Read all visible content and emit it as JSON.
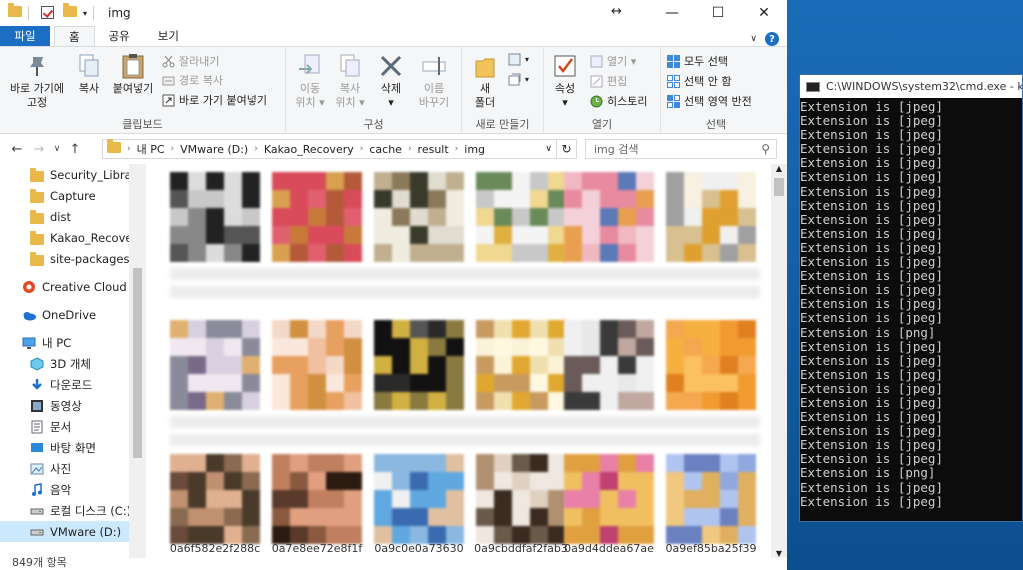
{
  "explorer": {
    "title": "img",
    "window_buttons": {
      "minimize": "—",
      "maximize": "☐",
      "close": "✕"
    },
    "resize_cursor": "↔",
    "tabs": [
      "파일",
      "홈",
      "공유",
      "보기"
    ],
    "ribbon": {
      "clipboard": {
        "label": "클립보드",
        "pin": "바로 가기에\n고정",
        "copy": "복사",
        "paste": "붙여넣기",
        "cut": "잘라내기",
        "copy_path": "경로 복사",
        "paste_shortcut": "바로 가기 붙여넣기"
      },
      "organize": {
        "label": "구성",
        "move_to": "이동\n위치 ▾",
        "copy_to": "복사\n위치 ▾",
        "delete": "삭제\n▾",
        "rename": "이름\n바꾸기"
      },
      "new": {
        "label": "새로 만들기",
        "new_folder": "새\n폴더"
      },
      "open": {
        "label": "열기",
        "properties": "속성\n▾",
        "open": "열기 ▾",
        "edit": "편집",
        "history": "히스토리"
      },
      "select": {
        "label": "선택",
        "select_all": "모두 선택",
        "select_none": "선택 안 함",
        "invert": "선택 영역 반전"
      }
    },
    "breadcrumb": [
      "내 PC",
      "VMware (D:)",
      "Kakao_Recovery",
      "cache",
      "result",
      "img"
    ],
    "search_placeholder": "img 검색",
    "nav_items": [
      {
        "label": "Security_Libra",
        "icon": "folder-icon"
      },
      {
        "label": "Capture",
        "icon": "folder-icon"
      },
      {
        "label": "dist",
        "icon": "folder-icon"
      },
      {
        "label": "Kakao_Recovery",
        "icon": "folder-icon"
      },
      {
        "label": "site-packages",
        "icon": "folder-icon"
      },
      {
        "label": "Creative Cloud Fil",
        "icon": "creative-cloud-icon"
      },
      {
        "label": "OneDrive",
        "icon": "onedrive-icon"
      },
      {
        "label": "내 PC",
        "icon": "pc-icon"
      },
      {
        "label": "3D 개체",
        "icon": "3d-objects-icon"
      },
      {
        "label": "다운로드",
        "icon": "download-icon"
      },
      {
        "label": "동영상",
        "icon": "video-icon"
      },
      {
        "label": "문서",
        "icon": "document-icon"
      },
      {
        "label": "바탕 화면",
        "icon": "desktop-icon"
      },
      {
        "label": "사진",
        "icon": "pictures-icon"
      },
      {
        "label": "음악",
        "icon": "music-icon"
      },
      {
        "label": "로컬 디스크 (C:)",
        "icon": "drive-icon"
      },
      {
        "label": "VMware (D:)",
        "icon": "drive-icon"
      }
    ],
    "file_names": [
      "0a6f582e2f288c",
      "0a7e8ee72e8f1f",
      "0a9c0e0a73630",
      "0a9cbddfaf2fab3",
      "0a9d4ddea67ae",
      "0a9ef85ba25f39"
    ],
    "status": "849개 항목",
    "colors": {
      "accent": "#1b6ec2",
      "selected": "#cce8ff"
    }
  },
  "cmd": {
    "title": "C:\\WINDOWS\\system32\\cmd.exe - k",
    "lines": [
      "Extension is [jpeg]",
      "Extension is [jpeg]",
      "Extension is [jpeg]",
      "Extension is [jpeg]",
      "Extension is [jpeg]",
      "Extension is [jpeg]",
      "Extension is [jpeg]",
      "Extension is [jpeg]",
      "Extension is [jpeg]",
      "Extension is [jpeg]",
      "Extension is [jpeg]",
      "Extension is [jpeg]",
      "Extension is [jpeg]",
      "Extension is [jpeg]",
      "Extension is [jpeg]",
      "Extension is [jpeg]",
      "Extension is [png]",
      "Extension is [jpeg]",
      "Extension is [jpeg]",
      "Extension is [jpeg]",
      "Extension is [jpeg]",
      "Extension is [jpeg]",
      "Extension is [jpeg]",
      "Extension is [jpeg]",
      "Extension is [jpeg]",
      "Extension is [jpeg]",
      "Extension is [png]",
      "Extension is [jpeg]",
      "Extension is [jpeg]"
    ]
  }
}
